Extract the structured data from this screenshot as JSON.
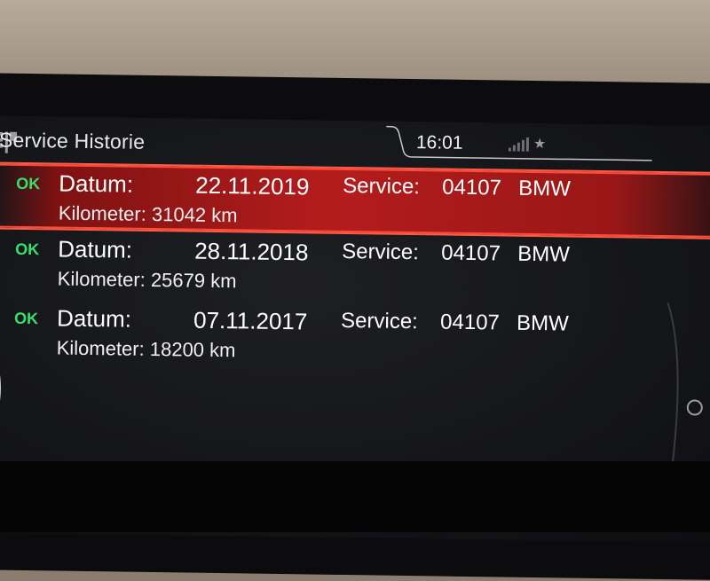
{
  "header": {
    "title": "Service Historie",
    "clock": "16:01",
    "icons": {
      "menu": "service-menu-icon",
      "signal": "signal-bars-icon",
      "bluetooth": "bluetooth-icon"
    }
  },
  "records": [
    {
      "status": "OK",
      "datum_label": "Datum:",
      "date": "22.11.2019",
      "service_label": "Service:",
      "service_code": "04107",
      "brand": "BMW",
      "km_label": "Kilometer:",
      "km": "31042 km",
      "selected": true
    },
    {
      "status": "OK",
      "datum_label": "Datum:",
      "date": "28.11.2018",
      "service_label": "Service:",
      "service_code": "04107",
      "brand": "BMW",
      "km_label": "Kilometer:",
      "km": "25679 km",
      "selected": false
    },
    {
      "status": "OK",
      "datum_label": "Datum:",
      "date": "07.11.2017",
      "service_label": "Service:",
      "service_code": "04107",
      "brand": "BMW",
      "km_label": "Kilometer:",
      "km": "18200 km",
      "selected": false
    }
  ],
  "colors": {
    "ok": "#36e06a",
    "highlight": "#b41c1c",
    "highlight_edge": "#ff5a46",
    "background": "#141518"
  }
}
